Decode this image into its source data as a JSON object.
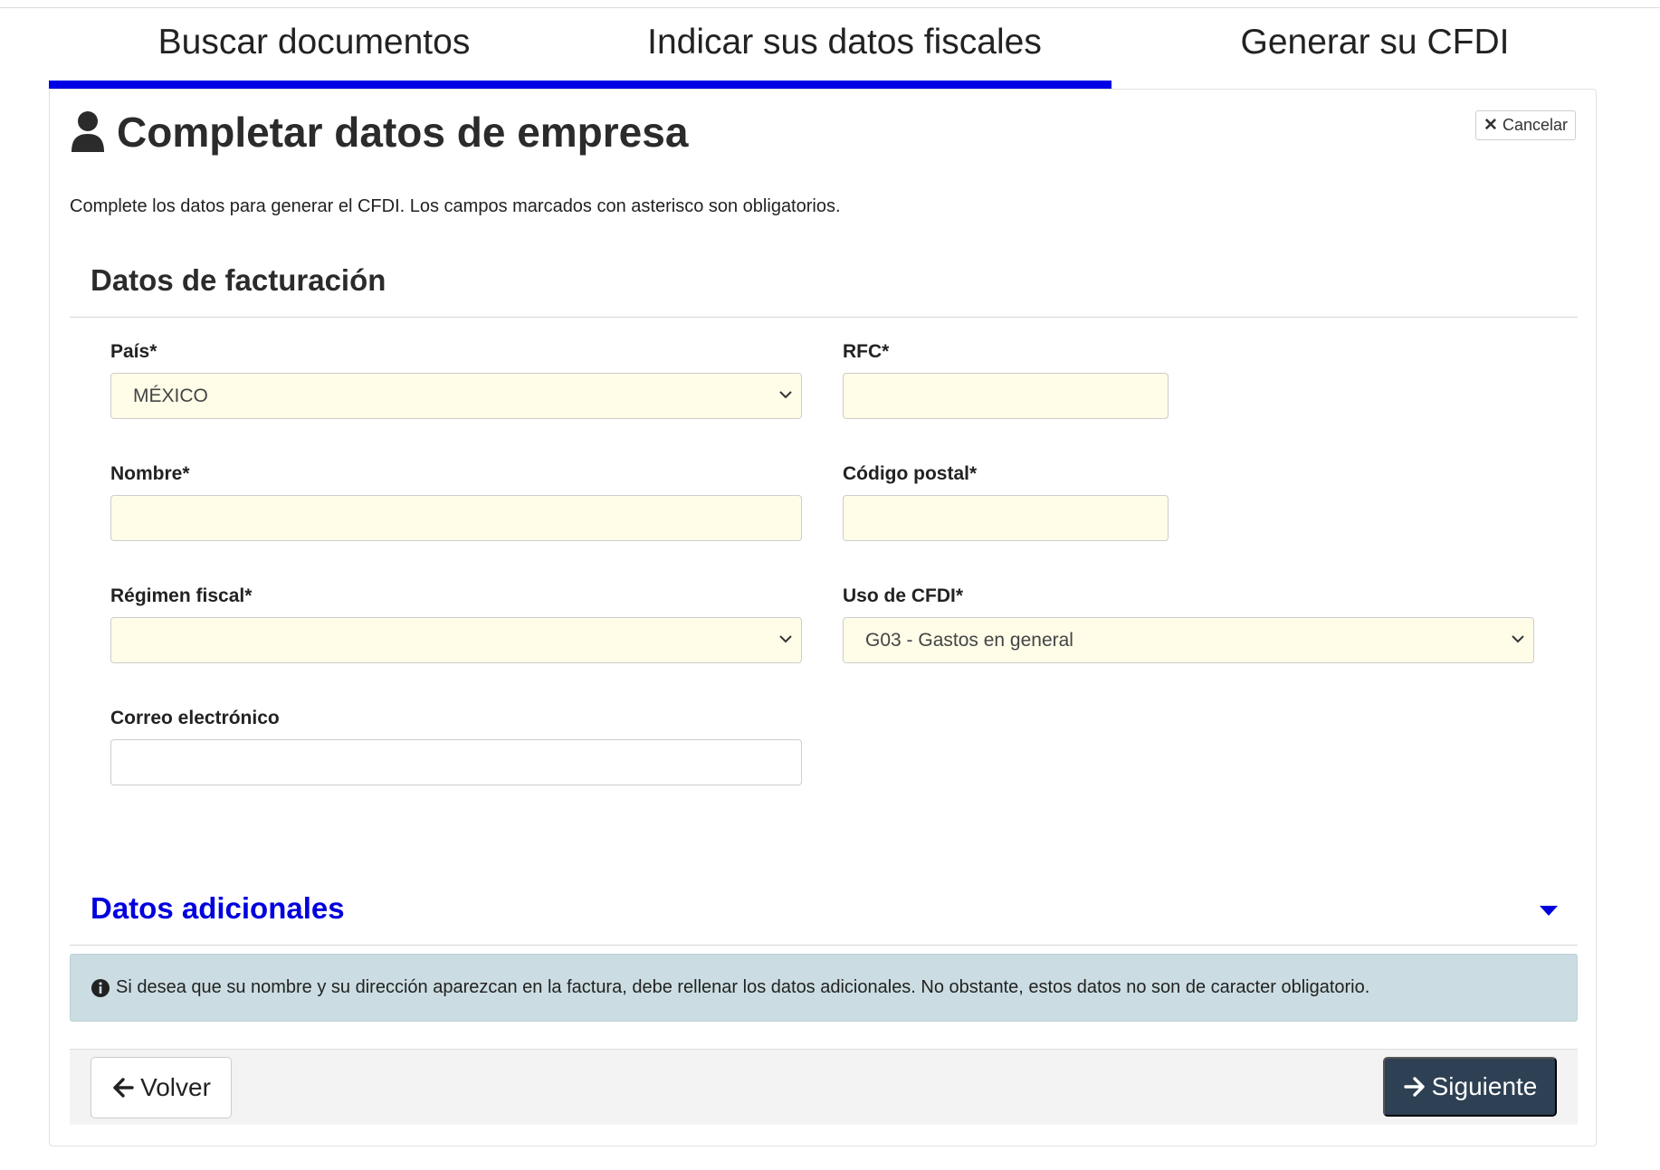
{
  "stepper": {
    "steps": [
      {
        "label": "Buscar documentos"
      },
      {
        "label": "Indicar sus datos fiscales"
      },
      {
        "label": "Generar su CFDI"
      }
    ],
    "progress_fraction": 0.667,
    "progress_color": "#0000e6"
  },
  "page": {
    "title": "Completar datos de empresa",
    "title_icon": "user-icon",
    "cancel_label": "Cancelar",
    "intro": "Complete los datos para generar el CFDI. Los campos marcados con asterisco son obligatorios."
  },
  "billing": {
    "section_title": "Datos de facturación",
    "pais": {
      "label": "País*",
      "value": "MÉXICO"
    },
    "rfc": {
      "label": "RFC*",
      "value": ""
    },
    "nombre": {
      "label": "Nombre*",
      "value": ""
    },
    "codigo_postal": {
      "label": "Código postal*",
      "value": ""
    },
    "regimen_fiscal": {
      "label": "Régimen fiscal*",
      "value": ""
    },
    "uso_cfdi": {
      "label": "Uso de CFDI*",
      "value": "G03 - Gastos en general"
    },
    "correo": {
      "label": "Correo electrónico",
      "value": ""
    }
  },
  "extra": {
    "section_title": "Datos adicionales",
    "alert": "Si desea que su nombre y su dirección aparezcan en la factura, debe rellenar los datos adicionales. No obstante, estos datos no son de caracter obligatorio."
  },
  "footer": {
    "back_label": "Volver",
    "next_label": "Siguiente"
  },
  "colors": {
    "required_field_bg": "#fffde8",
    "accent_link": "#0000dd",
    "primary_button": "#2e4053",
    "alert_bg": "#cbdde2"
  }
}
